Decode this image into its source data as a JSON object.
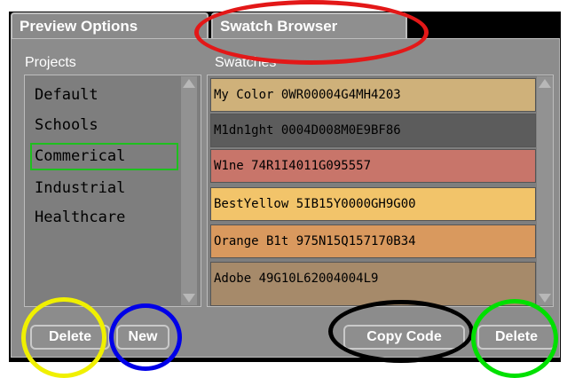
{
  "tabs": {
    "preview_options": "Preview Options",
    "swatch_browser": "Swatch Browser"
  },
  "projects": {
    "heading": "Projects",
    "items": [
      "Default",
      "Schools",
      "Commerical",
      "Industrial",
      "Healthcare"
    ],
    "selected": "Commerical"
  },
  "swatches": {
    "heading": "Swatches",
    "items": [
      {
        "label": "My Color 0WR00004G4MH4203",
        "color": "#cfb17a"
      },
      {
        "label": "M1dn1ght 0004D008M0E9BF86",
        "color": "#5c5c5c"
      },
      {
        "label": "W1ne 74R1I4011G095557",
        "color": "#c8756a"
      },
      {
        "label": "BestYellow 5IB15Y0000GH9G00",
        "color": "#f2c46a"
      },
      {
        "label": "Orange B1t 975N15Q157170B34",
        "color": "#d9995e"
      },
      {
        "label": "Adobe 49G10L62004004L9",
        "color": "#a68a6a"
      }
    ]
  },
  "buttons": {
    "delete_left": "Delete",
    "new": "New",
    "copy_code": "Copy Code",
    "delete_right": "Delete"
  },
  "annotations": {
    "red": "#e31818",
    "yellow": "#f0f000",
    "blue": "#0000e8",
    "black": "#000000",
    "green": "#00e000"
  }
}
